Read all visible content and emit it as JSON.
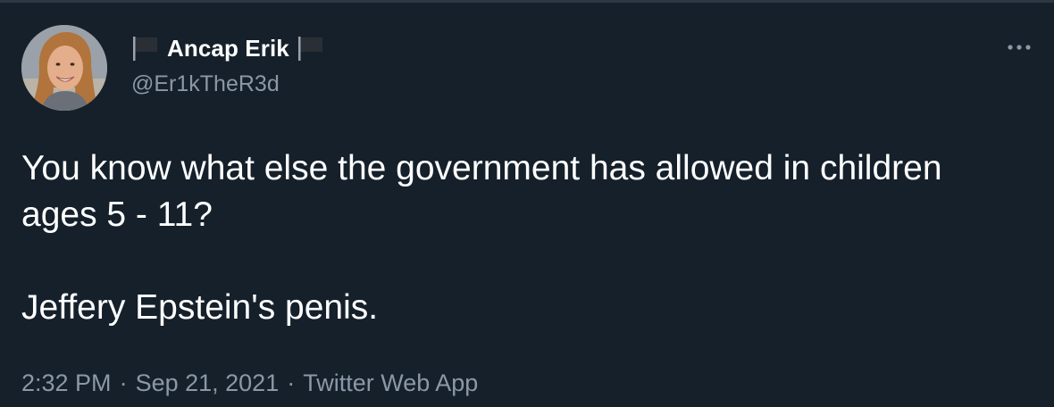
{
  "author": {
    "display_name": "Ancap Erik",
    "handle": "@Er1kTheR3d",
    "avatar_icon": "profile-photo",
    "name_emoji_icon": "black-flag-icon"
  },
  "tweet": {
    "paragraphs": [
      "You know what else the government has allowed in children ages 5 - 11?",
      "Jeffery Epstein's penis."
    ]
  },
  "meta": {
    "time": "2:32 PM",
    "separator": "·",
    "date": "Sep 21, 2021",
    "source": "Twitter Web App"
  },
  "actions": {
    "more_icon": "more-horizontal-icon"
  },
  "colors": {
    "background": "#15202b",
    "text_primary": "#ffffff",
    "text_secondary": "#8b98a5"
  }
}
